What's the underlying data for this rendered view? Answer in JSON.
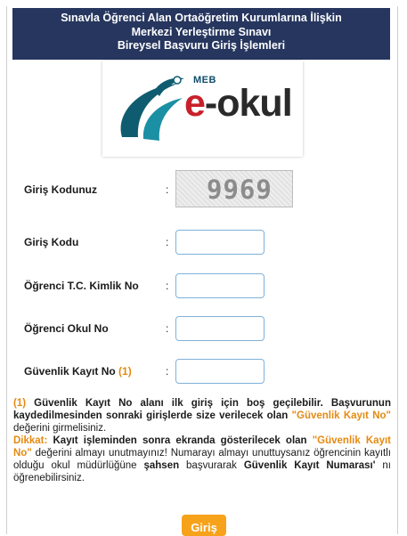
{
  "header": {
    "line1": "Sınavla Öğrenci Alan Ortaöğretim Kurumlarına İlişkin",
    "line2": "Merkezi Yerleştirme Sınavı",
    "line3": "Bireysel Başvuru Giriş İşlemleri"
  },
  "logo": {
    "meb": "MEB",
    "e": "e",
    "okul": "-okul"
  },
  "colon": ":",
  "form": {
    "captcha_label": "Giriş Kodunuz",
    "captcha_value": "9969",
    "giris_kodu_label": "Giriş Kodu",
    "tc_label": "Öğrenci T.C. Kimlik No",
    "okul_no_label": "Öğrenci Okul No",
    "guvenlik_label": "Güvenlik Kayıt No",
    "guvenlik_ref": "(1)",
    "giris_kodu_value": "",
    "tc_value": "",
    "okul_no_value": "",
    "guvenlik_value": ""
  },
  "notes": {
    "n1_ref": "(1)",
    "n1_text_a": " Güvenlik Kayıt No alanı ilk giriş için boş geçilebilir. Başvurunun kaydedilmesinden sonraki girişlerde size verilecek olan ",
    "n1_quoted": "\"Güvenlik Kayıt No\"",
    "n1_text_b": " değerini girmelisiniz.",
    "n2_label": "Dikkat:",
    "n2_text_a": " Kayıt işleminden sonra ekranda gösterilecek olan ",
    "n2_quoted": "\"Güvenlik Kayıt No\"",
    "n2_text_b": " değerini almayı unutmayınız! Numarayı almayı unuttuysanız öğrencinin kayıtlı olduğu okul müdürlüğüne ",
    "n2_bold": "şahsen",
    "n2_text_c": " başvurarak ",
    "n2_bold2": "Güvenlik Kayıt Numarası'",
    "n2_text_d": " nı öğrenebilirsiniz."
  },
  "submit_label": "Giriş",
  "colors": {
    "header_bg": "#26365e",
    "accent_orange": "#f7a21b",
    "highlight_orange": "#e58a12",
    "logo_red": "#c8202a",
    "input_border": "#7fb2d9"
  }
}
